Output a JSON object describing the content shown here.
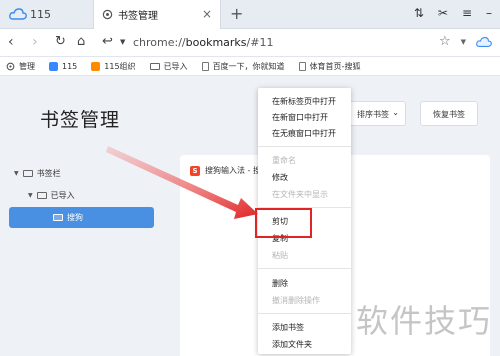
{
  "tabs": [
    {
      "label": "115"
    },
    {
      "label": "书签管理"
    }
  ],
  "address": {
    "host": "chrome://",
    "path": "bookmarks",
    "hash": "/#11"
  },
  "bookmarks_bar": [
    {
      "label": "管理",
      "icon": "gear-icon"
    },
    {
      "label": "115",
      "icon": "115-icon"
    },
    {
      "label": "115组织",
      "icon": "115org-icon"
    },
    {
      "label": "已导入",
      "icon": "folder-icon"
    },
    {
      "label": "百度一下，你就知道",
      "icon": "doc-icon"
    },
    {
      "label": "体育首页-搜狐",
      "icon": "doc-icon"
    }
  ],
  "page": {
    "title": "书签管理",
    "sort_label": "排序书签",
    "restore_label": "恢复书签"
  },
  "tree": {
    "root": "书签栏",
    "child": "已导入",
    "selected": "搜狗"
  },
  "list": {
    "item": "搜狗输入法 - 搜"
  },
  "context_menu": {
    "open_new_tab": "在新标签页中打开",
    "open_new_window": "在新窗口中打开",
    "open_incognito": "在无痕窗口中打开",
    "rename": "重命名",
    "edit": "修改",
    "show_in_folder": "在文件夹中显示",
    "cut": "剪切",
    "copy": "复制",
    "paste": "粘贴",
    "delete": "删除",
    "undo_delete": "撤消删除操作",
    "add_bookmark": "添加书签",
    "add_folder": "添加文件夹"
  },
  "watermark": "软件技巧",
  "colors": {
    "accent": "#4a90e2",
    "highlight": "#e02424",
    "arrow": "#e02424"
  }
}
